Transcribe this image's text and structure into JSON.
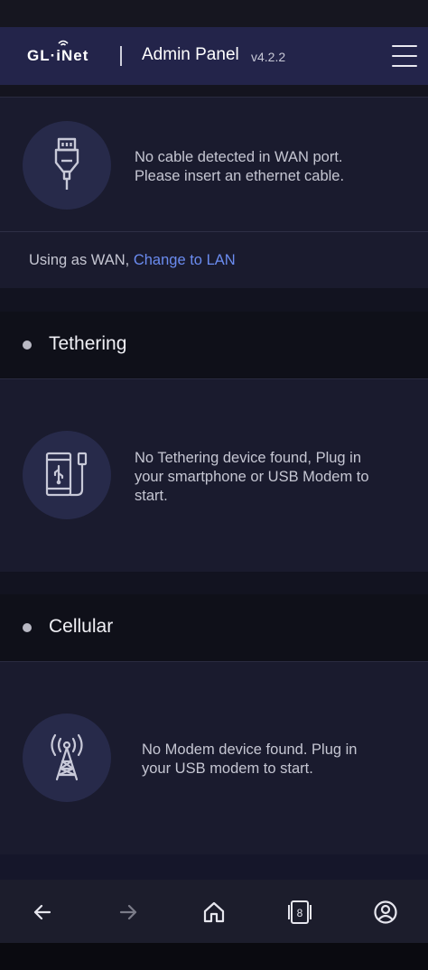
{
  "header": {
    "logo_text": "GL·iNet",
    "title": "Admin Panel",
    "version": "v4.2.2",
    "menu_icon": "hamburger-menu-icon"
  },
  "wan": {
    "icon": "ethernet-cable-icon",
    "message_line1": "No cable detected in WAN port.",
    "message_line2": "Please insert an ethernet cable.",
    "using_as": "Using as WAN, ",
    "change_link": "Change to LAN"
  },
  "tethering": {
    "title": "Tethering",
    "icon": "phone-usb-icon",
    "message_line1": "No Tethering device found, Plug in",
    "message_line2": "your smartphone or USB Modem to",
    "message_line3": "start."
  },
  "cellular": {
    "title": "Cellular",
    "icon": "cell-tower-icon",
    "message_line1": "No Modem device found. Plug in",
    "message_line2": "your USB modem to start."
  },
  "nav": {
    "back_icon": "arrow-left-icon",
    "forward_icon": "arrow-right-icon",
    "home_icon": "home-icon",
    "tabs_icon": "tabs-icon",
    "tabs_count": "8",
    "profile_icon": "profile-icon"
  },
  "colors": {
    "header_bg": "#23244a",
    "card_bg": "#1a1b2e",
    "link": "#6b8cf0"
  }
}
